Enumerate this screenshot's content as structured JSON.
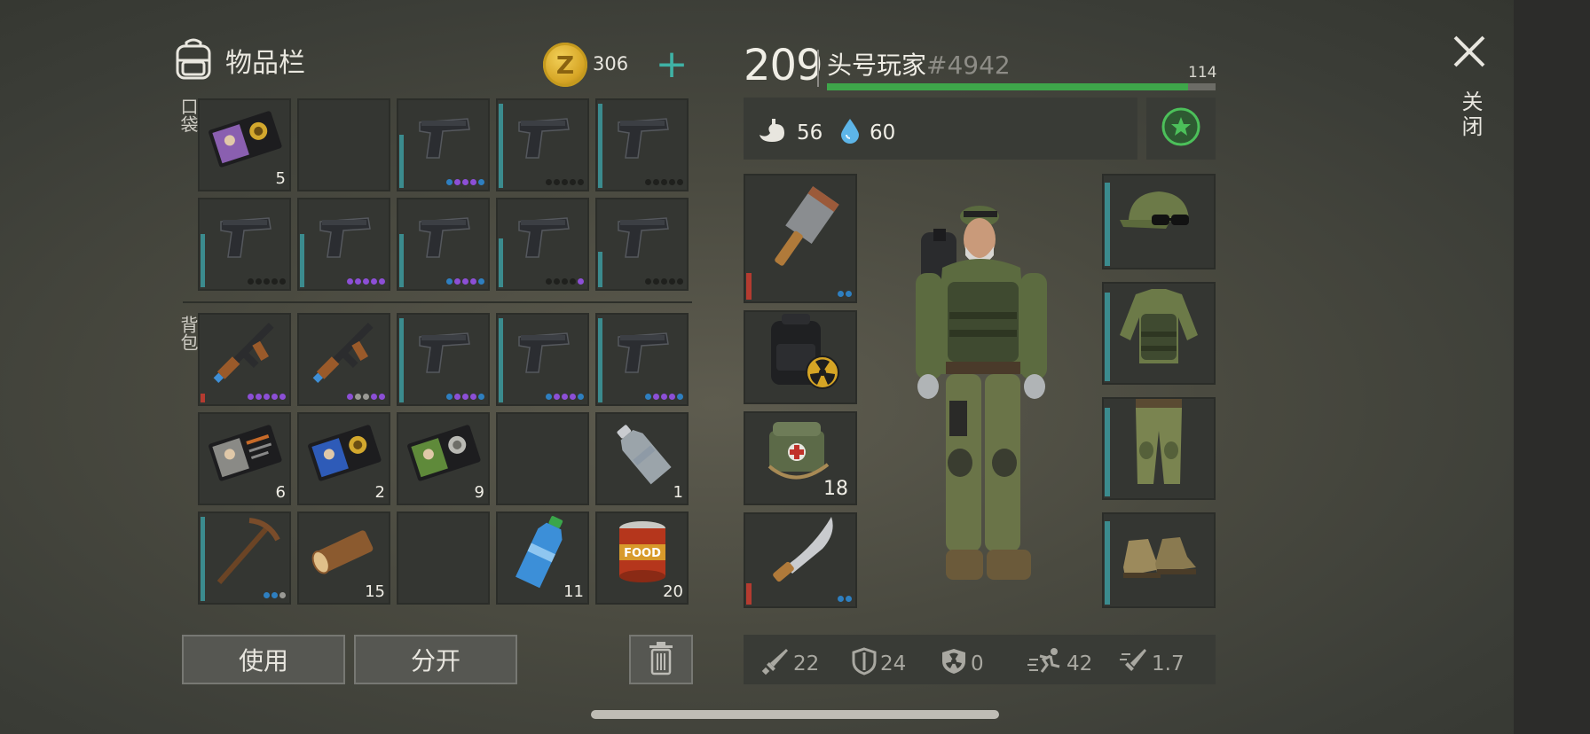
{
  "inventory": {
    "title": "物品栏",
    "coins": "306",
    "coin_symbol": "Z",
    "pocket_label": "口袋",
    "backpack_label": "背包",
    "pocket_slots": [
      {
        "item": "badge-card-purple",
        "qty": "5"
      },
      {
        "item": "empty",
        "qty": ""
      },
      {
        "item": "pistol",
        "qty": ""
      },
      {
        "item": "pistol",
        "qty": ""
      },
      {
        "item": "pistol",
        "qty": ""
      },
      {
        "item": "pistol",
        "qty": ""
      },
      {
        "item": "pistol",
        "qty": ""
      },
      {
        "item": "pistol",
        "qty": ""
      },
      {
        "item": "pistol",
        "qty": ""
      },
      {
        "item": "pistol",
        "qty": ""
      }
    ],
    "backpack_slots": [
      {
        "item": "assault-rifle",
        "qty": ""
      },
      {
        "item": "assault-rifle",
        "qty": ""
      },
      {
        "item": "pistol",
        "qty": ""
      },
      {
        "item": "pistol",
        "qty": ""
      },
      {
        "item": "pistol",
        "qty": ""
      },
      {
        "item": "id-card-gray",
        "qty": "6"
      },
      {
        "item": "badge-card-blue",
        "qty": "2"
      },
      {
        "item": "badge-card-green",
        "qty": "9"
      },
      {
        "item": "empty",
        "qty": ""
      },
      {
        "item": "plastic-bottle-empty",
        "qty": "1"
      },
      {
        "item": "pickaxe",
        "qty": ""
      },
      {
        "item": "log",
        "qty": "15"
      },
      {
        "item": "empty",
        "qty": ""
      },
      {
        "item": "water-bottle",
        "qty": "11"
      },
      {
        "item": "canned-food",
        "qty": "20"
      }
    ],
    "use_button": "使用",
    "split_button": "分开"
  },
  "character": {
    "level": "209",
    "name": "头号玩家",
    "tag": "#4942",
    "xp_label": "114",
    "xp_fraction": 0.93,
    "food": "56",
    "water": "60",
    "weapon_slots": [
      {
        "item": "cleaver",
        "qty": ""
      },
      {
        "item": "radiation-backpack",
        "qty": ""
      },
      {
        "item": "medkit-bag",
        "qty": "18"
      },
      {
        "item": "machete",
        "qty": ""
      }
    ],
    "armor_slots": [
      {
        "item": "camo-cap-sunglasses"
      },
      {
        "item": "camo-jacket-vest"
      },
      {
        "item": "camo-pants"
      },
      {
        "item": "boots"
      }
    ],
    "stats": {
      "attack": "22",
      "defense": "24",
      "radiation": "0",
      "speed": "42",
      "attack_speed": "1.7"
    }
  },
  "close_label": "关闭",
  "colors": {
    "accent_teal": "#3fb2a5",
    "xp_green": "#3ea64a",
    "durability_teal": "#3b8b8e",
    "durability_red": "#b43b30",
    "rarity_purple": "#8c4fd6",
    "rarity_blue": "#2e7fc0",
    "coin_gold": "#d6a525"
  }
}
